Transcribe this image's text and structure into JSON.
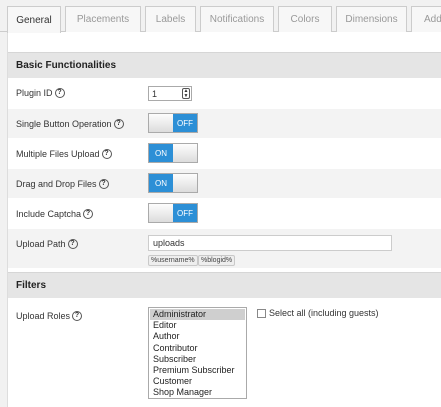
{
  "tabs": [
    {
      "label": "General",
      "active": true
    },
    {
      "label": "Placements"
    },
    {
      "label": "Labels"
    },
    {
      "label": "Notifications"
    },
    {
      "label": "Colors"
    },
    {
      "label": "Dimensions"
    },
    {
      "label": "Add"
    }
  ],
  "sections": {
    "basic": "Basic Functionalities",
    "filters": "Filters"
  },
  "fields": {
    "plugin_id": {
      "label": "Plugin ID",
      "value": "1"
    },
    "single_button": {
      "label": "Single Button Operation",
      "state": "OFF"
    },
    "multiple_files": {
      "label": "Multiple Files Upload",
      "state": "ON"
    },
    "drag_drop": {
      "label": "Drag and Drop Files",
      "state": "ON"
    },
    "captcha": {
      "label": "Include Captcha",
      "state": "OFF"
    },
    "upload_path": {
      "label": "Upload Path",
      "value": "uploads",
      "chips": [
        "%username%",
        "%blogid%"
      ]
    },
    "upload_roles": {
      "label": "Upload Roles",
      "options": [
        "Administrator",
        "Editor",
        "Author",
        "Contributor",
        "Subscriber",
        "Premium Subscriber",
        "Customer",
        "Shop Manager"
      ],
      "selected": "Administrator",
      "select_all_label": "Select all (including guests)"
    }
  },
  "help_glyph": "?",
  "colors": {
    "toggle_on": "#2c8fd6"
  }
}
